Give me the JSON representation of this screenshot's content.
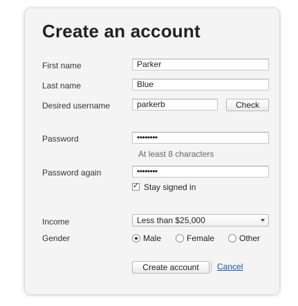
{
  "form": {
    "title": "Create an account",
    "first_name": {
      "label": "First name",
      "value": "Parker"
    },
    "last_name": {
      "label": "Last name",
      "value": "Blue"
    },
    "username": {
      "label": "Desired username",
      "value": "parkerb",
      "check_label": "Check"
    },
    "password": {
      "label": "Password",
      "value": "••••••••",
      "hint": "At least 8 characters"
    },
    "password_again": {
      "label": "Password again",
      "value": "••••••••"
    },
    "stay_signed_in": {
      "label": "Stay signed in",
      "checked": true
    },
    "income": {
      "label": "Income",
      "selected": "Less than $25,000"
    },
    "gender": {
      "label": "Gender",
      "options": [
        "Male",
        "Female",
        "Other"
      ],
      "selected": "Male"
    },
    "submit_label": "Create account",
    "cancel_label": "Cancel"
  },
  "icons": {
    "checkbox_checked": "check-icon",
    "select_arrow": "chevron-down-icon",
    "radio_selected": "radio-dot-icon"
  },
  "colors": {
    "card_background": "#f4f4f4",
    "link": "#1a4fb0",
    "text": "#333333"
  }
}
